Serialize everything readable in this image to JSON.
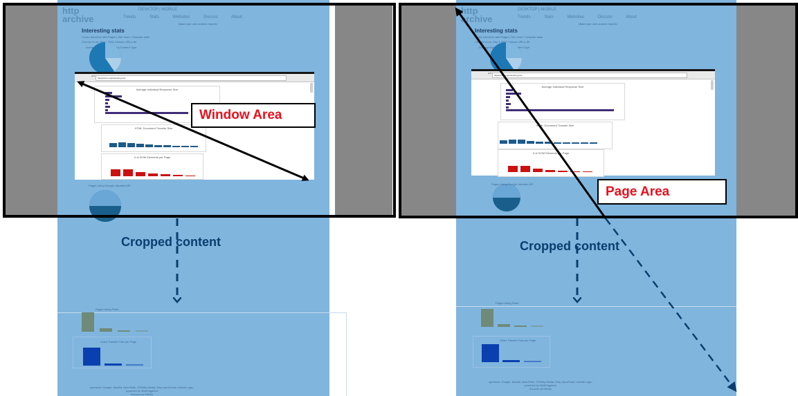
{
  "left": {
    "site": {
      "logo_top": "http",
      "logo_bottom": "archive",
      "nav_active": "DESKTOP | MOBILE",
      "nav": [
        "Trends",
        "Stats",
        "Websites",
        "Discuss",
        "About"
      ],
      "notice": "Make your own custom reports!",
      "title": "Interesting stats",
      "subtitle": "Cross reference with Pages  |  See more: Compare stats",
      "filters": "Choose a run: Sep 1 2015   Choose URLs: All",
      "top_card_title": "Average Bytes per Page by Content Type",
      "bottom_card_title": "Pages Using Google Libraries API"
    },
    "browser": {
      "tab": "HTTP Archive - Interesting Stats",
      "address": "httparchive.org/interesting.php",
      "chart1_title": "Average Individual Response Size",
      "chart2_title": "HTML Document Transfer Size",
      "chart3_title": "# of DOM Elements per Page"
    },
    "label": "Window Area",
    "cropped": "Cropped content",
    "crop_chart_title": "Pages Using Flash",
    "crop_chart2_title": "Video Transfer Size per Page",
    "footer_line1": "sponsors: Google, Mozilla, New Relic, O'Reilly Media, Etsy, dynaTrace, Instart Logic, Catchpoint Systems, Fastly",
    "footer_line2": "powered by WebPagetest",
    "footer_line3": "Sources at GitHub"
  },
  "right": {
    "site": {
      "logo_top": "http",
      "logo_bottom": "archive",
      "nav_active": "DESKTOP | MOBILE",
      "nav": [
        "Trends",
        "Stats",
        "Websites",
        "Discuss",
        "About"
      ],
      "notice": "Make your own custom reports!",
      "title": "Interesting stats",
      "subtitle": "Cross reference with Pages  |  See more: Compare stats",
      "filters": "Choose a run: Sep 1 2015   Choose URLs: All",
      "top_card_title": "Average Bytes per Page by Content Type",
      "bottom_card_title": "Pages Using Google Libraries API"
    },
    "browser": {
      "tab": "HTTP Archive - Interesting Stats",
      "address": "httparchive.org/interesting.php",
      "chart1_title": "Average Individual Response Size",
      "chart2_title": "HTML Document Transfer Size",
      "chart3_title": "# of DOM Elements per Page"
    },
    "label": "Page Area",
    "cropped": "Cropped content",
    "crop_chart_title": "Pages Using Flash",
    "crop_chart2_title": "Video Transfer Size per Page",
    "footer_line1": "sponsors: Google, Mozilla, New Relic, O'Reilly Media, Etsy, dynaTrace, Instart Logic, Catchpoint Systems, Fastly",
    "footer_line2": "powered by WebPagetest",
    "footer_line3": "Sources at GitHub"
  },
  "colors": {
    "page_background": "#80b5de",
    "side_gray": "#878787",
    "label_red": "#e8101d",
    "cropped_text": "#0a3e6e",
    "dashed_arrow": "#0a3e6e",
    "bar_purple": "#3f2d77",
    "bar_teal": "#1c5a8a",
    "bar_red": "#cc1111",
    "bar_green": "#6f8a78",
    "bar_blue": "#0a3fb0"
  }
}
